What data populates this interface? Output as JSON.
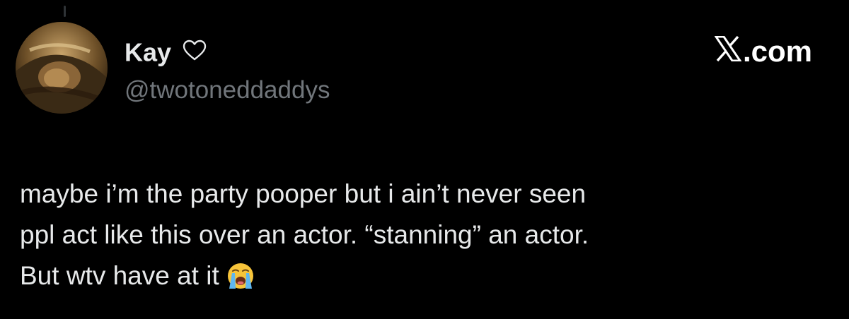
{
  "tweet": {
    "author": {
      "display_name": "Kay",
      "name_icon": "heart-outline-icon",
      "handle": "@twotoneddaddys",
      "avatar": "profile-photo"
    },
    "brand": {
      "logo_icon": "x-logo-icon",
      "label": ".com"
    },
    "text_lines": [
      "maybe i’m the party pooper but i ain’t never seen",
      "ppl act like this over an actor. “stanning” an actor.",
      "But wtv have at it"
    ],
    "emoji": "loudly-crying-face-icon"
  },
  "colors": {
    "background": "#000000",
    "primary_text": "#e7e9ea",
    "secondary_text": "#71767b"
  }
}
